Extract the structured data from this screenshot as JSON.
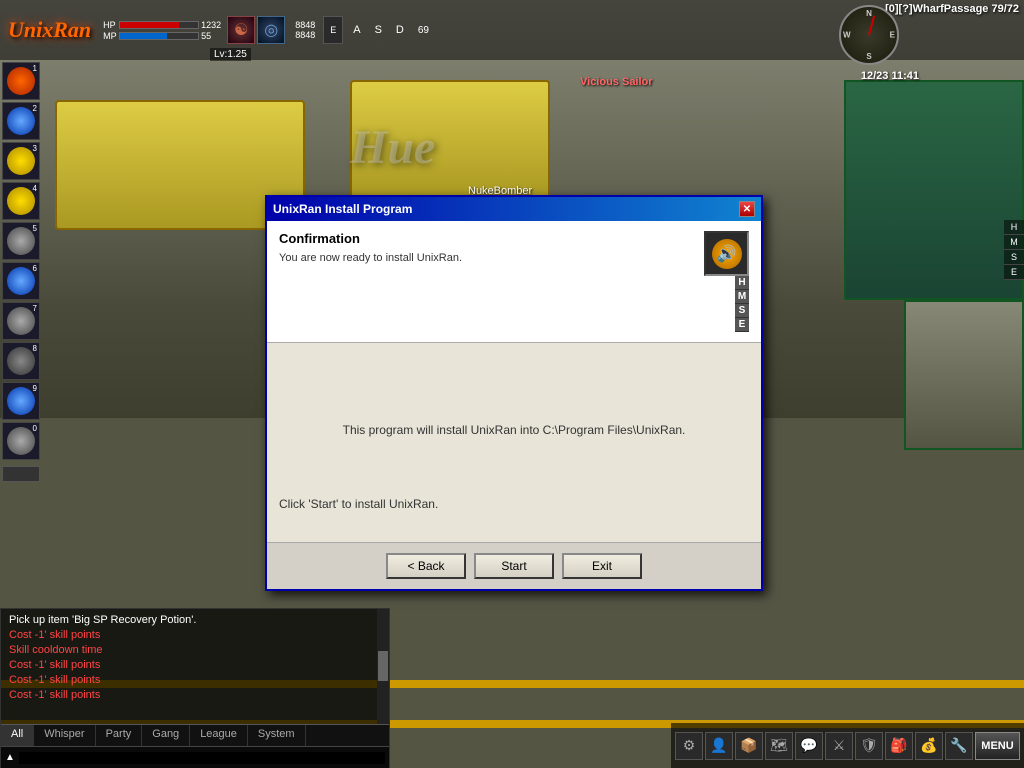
{
  "game": {
    "title": "UnixRan",
    "watermark": "Hue",
    "location": "[0][?]WharfPassage 79/72",
    "datetime": "12/23 11:41",
    "level": "Lv:1.25"
  },
  "hud": {
    "hp_label": "HP",
    "mp_label": "MP",
    "hp_value": "1232",
    "mp_value": "55",
    "energy1": "8848",
    "energy2": "8848",
    "attr_a": "A",
    "attr_s": "S",
    "attr_d": "D",
    "val_69": "69"
  },
  "compass_dirs": {
    "n": "N",
    "s": "S",
    "e": "E",
    "w": "W"
  },
  "right_panel_letters": [
    "H",
    "M",
    "S",
    "E"
  ],
  "npc": {
    "name": "Vicious Sailor",
    "player": "NukeBomber"
  },
  "dialog": {
    "title": "UnixRan Install Program",
    "close_label": "✕",
    "section_title": "Confirmation",
    "section_text": "You are now ready to install UnixRan.",
    "main_text": "This program will install UnixRan into C:\\Program Files\\UnixRan.",
    "bottom_text": "Click 'Start' to install UnixRan.",
    "btn_back": "< Back",
    "btn_start": "Start",
    "btn_exit": "Exit"
  },
  "chat": {
    "lines": [
      {
        "text": "Pick up item 'Big SP Recovery Potion'.",
        "style": "white"
      },
      {
        "text": "Cost -1' skill points",
        "style": "red"
      },
      {
        "text": "Skill cooldown time",
        "style": "red"
      },
      {
        "text": "Cost -1' skill points",
        "style": "red"
      },
      {
        "text": "Cost -1' skill points",
        "style": "red"
      },
      {
        "text": "Cost -1' skill points",
        "style": "red"
      }
    ],
    "tabs": [
      {
        "label": "All",
        "active": true
      },
      {
        "label": "Whisper",
        "active": false
      },
      {
        "label": "Party",
        "active": false
      },
      {
        "label": "Gang",
        "active": false
      },
      {
        "label": "League",
        "active": false
      },
      {
        "label": "System",
        "active": false
      }
    ]
  },
  "skills": [
    {
      "num": "1",
      "type": "fire"
    },
    {
      "num": "2",
      "type": "ice"
    },
    {
      "num": "3",
      "type": "yellow"
    },
    {
      "num": "4",
      "type": "yellow"
    },
    {
      "num": "5",
      "type": "sword"
    },
    {
      "num": "6",
      "type": "ice"
    },
    {
      "num": "7",
      "type": "sword"
    },
    {
      "num": "8",
      "type": "gray"
    },
    {
      "num": "9",
      "type": "ice"
    },
    {
      "num": "0",
      "type": "sword"
    }
  ],
  "bottom_icons": [
    "⚙",
    "👤",
    "📦",
    "🗺",
    "💬",
    "⚔",
    "🛡",
    "🎒",
    "💰",
    "🔧"
  ],
  "menu_label": "MENU"
}
